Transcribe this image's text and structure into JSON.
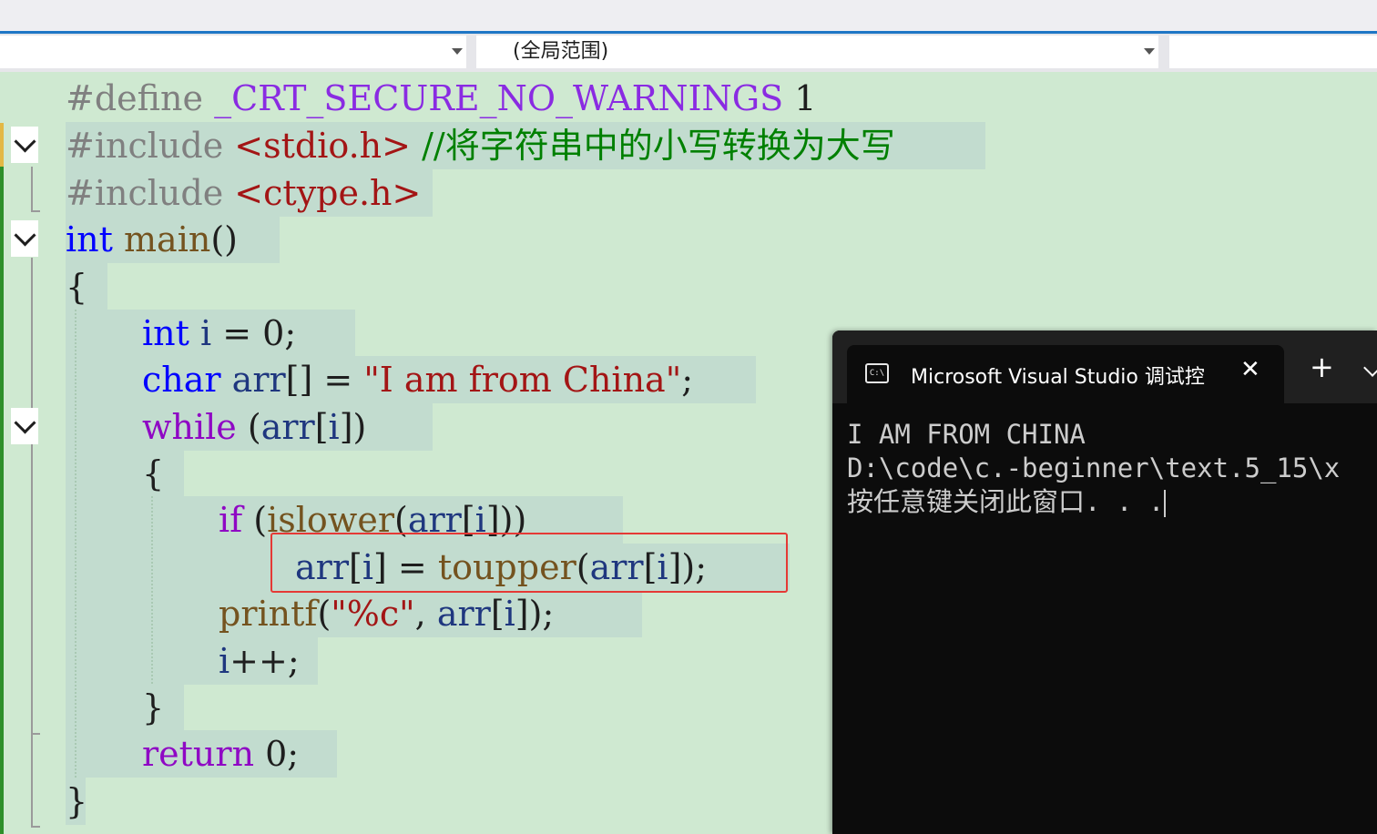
{
  "navigation": {
    "left_dropdown": "",
    "scope_dropdown": "(全局范围)",
    "right_dropdown": ""
  },
  "code": {
    "l1": {
      "pp": "#define",
      "macro": "_CRT_SECURE_NO_WARNINGS",
      "val": "1"
    },
    "l2": {
      "pp": "#include",
      "header": "<stdio.h>",
      "comment": "//将字符串中的小写转换为大写"
    },
    "l3": {
      "pp": "#include",
      "header": "<ctype.h>"
    },
    "l4": {
      "type": "int",
      "func": "main",
      "paren": "()"
    },
    "l5": {
      "brace": "{"
    },
    "l6": {
      "type": "int",
      "var": "i",
      "rest": " = 0;"
    },
    "l7": {
      "type": "char",
      "var": "arr",
      "mid": "[] = ",
      "str": "\"I am from China\"",
      "end": ";"
    },
    "l8": {
      "kw": "while",
      "open": " (",
      "var": "arr",
      "mid": "[",
      "var2": "i",
      "end": "])"
    },
    "l9": {
      "brace": "{"
    },
    "l10": {
      "kw": "if",
      "open": " (",
      "func": "islower",
      "p1": "(",
      "var": "arr",
      "b1": "[",
      "var2": "i",
      "end": "]))"
    },
    "l11": {
      "var": "arr",
      "b1": "[",
      "var2": "i",
      "mid": "] = ",
      "func": "toupper",
      "p1": "(",
      "var3": "arr",
      "b2": "[",
      "var4": "i",
      "end": "]);"
    },
    "l12": {
      "func": "printf",
      "p1": "(",
      "str": "\"%c\"",
      "mid": ", ",
      "var": "arr",
      "b1": "[",
      "var2": "i",
      "end": "]);"
    },
    "l13": {
      "var": "i",
      "end": "++;"
    },
    "l14": {
      "brace": "}"
    },
    "l15": {
      "kw": "return",
      "end": " 0;"
    },
    "l16": {
      "brace": "}"
    }
  },
  "terminal": {
    "tab_title": "Microsoft Visual Studio 调试控",
    "icon_glyph": "C:\\",
    "close_glyph": "✕",
    "new_tab_glyph": "+",
    "output": [
      "I AM FROM CHINA",
      "D:\\code\\c.-beginner\\text.5_15\\x",
      "按任意键关闭此窗口. . ."
    ]
  }
}
